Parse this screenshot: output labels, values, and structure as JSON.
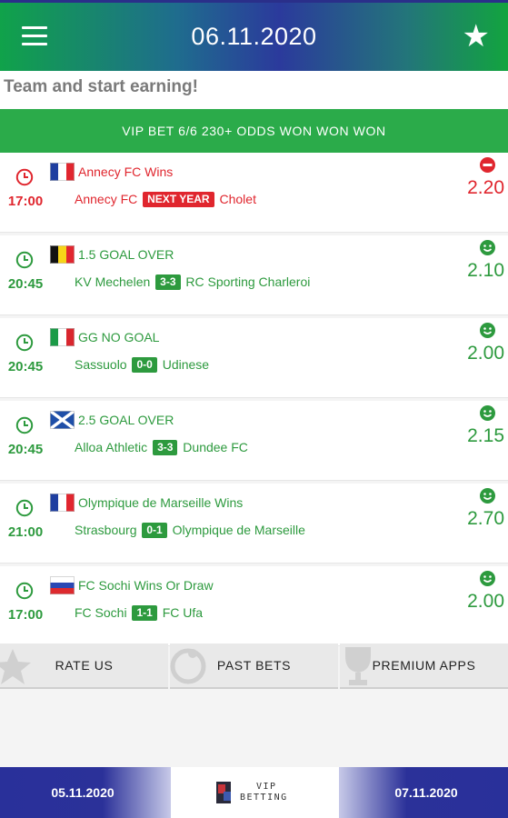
{
  "header": {
    "title": "06.11.2020",
    "menu_icon": "hamburger-menu-icon",
    "favorite_icon": "star-icon"
  },
  "marquee": {
    "text": "Team and start earning!"
  },
  "vip_banner": {
    "label": "VIP BET 6/6 230+ ODDS WON WON WON"
  },
  "colors": {
    "win": "#2d9a3e",
    "loss": "#e0262e",
    "header_blue": "#2b3a9c",
    "banner_green": "#2bab4a"
  },
  "bets": [
    {
      "time": "17:00",
      "flag": "france",
      "tip": "Annecy FC Wins",
      "home": "Annecy FC",
      "score": "NEXT YEAR",
      "away": "Cholet",
      "odds": "2.20",
      "status": "lost"
    },
    {
      "time": "20:45",
      "flag": "belgium",
      "tip": "1.5 GOAL OVER",
      "home": "KV Mechelen",
      "score": "3-3",
      "away": "RC Sporting Charleroi",
      "odds": "2.10",
      "status": "won"
    },
    {
      "time": "20:45",
      "flag": "italy",
      "tip": "GG NO GOAL",
      "home": "Sassuolo",
      "score": "0-0",
      "away": "Udinese",
      "odds": "2.00",
      "status": "won"
    },
    {
      "time": "20:45",
      "flag": "scotland",
      "tip": "2.5 GOAL OVER",
      "home": "Alloa Athletic",
      "score": "3-3",
      "away": "Dundee FC",
      "odds": "2.15",
      "status": "won"
    },
    {
      "time": "21:00",
      "flag": "france",
      "tip": "Olympique de Marseille Wins",
      "home": "Strasbourg",
      "score": "0-1",
      "away": "Olympique de Marseille",
      "odds": "2.70",
      "status": "won"
    },
    {
      "time": "17:00",
      "flag": "russia",
      "tip": "FC Sochi Wins Or Draw",
      "home": "FC Sochi",
      "score": "1-1",
      "away": "FC Ufa",
      "odds": "2.00",
      "status": "won"
    }
  ],
  "actions": {
    "rate_us": "RATE US",
    "past_bets": "PAST BETS",
    "premium_apps": "PREMIUM APPS"
  },
  "bottom_nav": {
    "prev_date": "05.11.2020",
    "next_date": "07.11.2020",
    "logo_line1": "VIP",
    "logo_line2": "BETTING"
  }
}
